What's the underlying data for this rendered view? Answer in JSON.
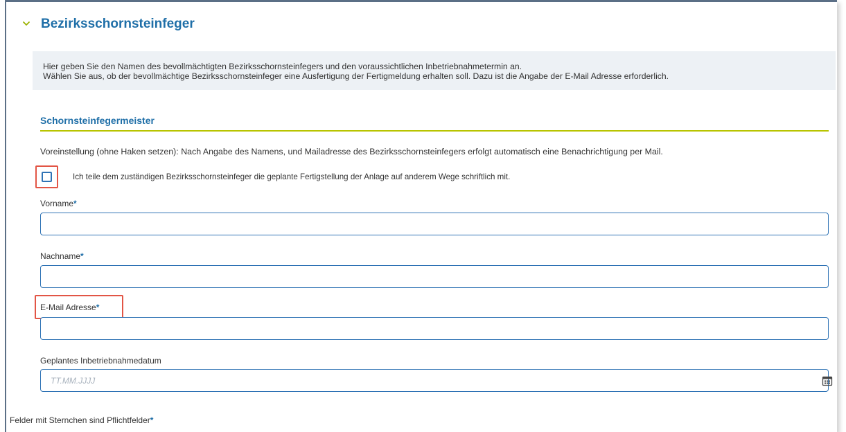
{
  "section": {
    "title": "Bezirksschornsteinfeger",
    "toggle_icon": "chevron-down-icon"
  },
  "info": {
    "line1": "Hier geben Sie den Namen des bevollmächtigten Bezirksschornsteinfegers und den voraussichtlichen Inbetriebnahmetermin an.",
    "line2": "Wählen Sie aus, ob der bevollmächtige Bezirksschornsteinfeger eine Ausfertigung der Fertigmeldung erhalten soll. Dazu ist die Angabe der E-Mail Adresse erforderlich."
  },
  "subsection": {
    "title": "Schornsteinfegermeister",
    "preset_text": "Voreinstellung (ohne Haken setzen): Nach Angabe des Namens, und Mailadresse des Bezirksschornsteinfegers erfolgt automatisch eine Benachrichtigung per Mail.",
    "checkbox_label": "Ich teile dem zuständigen Bezirksschornsteinfeger die geplante Fertigstellung der Anlage auf anderem Wege schriftlich mit.",
    "checkbox_checked": false
  },
  "fields": {
    "vorname": {
      "label": "Vorname",
      "required_mark": "*",
      "value": ""
    },
    "nachname": {
      "label": "Nachname",
      "required_mark": "*",
      "value": ""
    },
    "email": {
      "label": "E-Mail Adresse",
      "required_mark": "*",
      "value": ""
    },
    "datum": {
      "label": "Geplantes Inbetriebnahmedatum",
      "placeholder": "TT.MM.JJJJ",
      "icon": "calendar-icon"
    }
  },
  "footer": {
    "note": "Felder mit Sternchen sind Pflichtfelder",
    "required_mark": "*"
  },
  "colors": {
    "accent_blue": "#1f6fa8",
    "input_border": "#2f73b5",
    "rule_green": "#b8c400",
    "highlight_red": "#e25545",
    "info_background": "#edf1f5"
  }
}
